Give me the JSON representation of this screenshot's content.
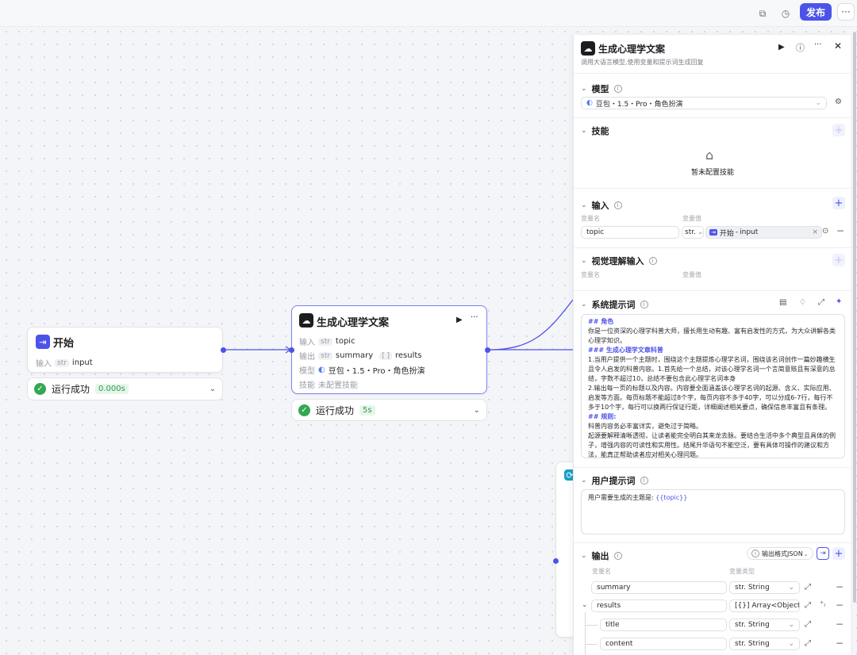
{
  "topbar": {
    "publish_label": "发布",
    "more_label": "···"
  },
  "canvas": {
    "start_node": {
      "title": "开始",
      "input_label": "输入",
      "input_type": "str",
      "input_name": "input",
      "status_text": "运行成功",
      "status_time": "0.000s"
    },
    "llm_node": {
      "title": "生成心理学文案",
      "input_label": "输入",
      "input_type": "str",
      "input_name": "topic",
      "output_label": "输出",
      "output_type1": "str",
      "output_name1": "summary",
      "output_type2": "[ ]",
      "output_name2": "results",
      "model_label": "模型",
      "model_value": "豆包・1.5・Pro・角色扮演",
      "skill_label": "技能",
      "skill_value": "未配置技能",
      "status_text": "运行成功",
      "status_time": "5s"
    }
  },
  "panel": {
    "title": "生成心理学文案",
    "subtitle": "调用大语言模型,使用变量和提示词生成回复",
    "model_section": {
      "title": "模型",
      "selected": "豆包・1.5・Pro・角色扮演"
    },
    "skill_section": {
      "title": "技能",
      "empty_text": "暂未配置技能"
    },
    "input_section": {
      "title": "输入",
      "col_name": "变量名",
      "col_value": "变量值",
      "var_name": "topic",
      "var_type": "str.",
      "ref_node": "开始",
      "ref_var": "input"
    },
    "vision_section": {
      "title": "视觉理解输入",
      "col_name": "变量名",
      "col_value": "变量值"
    },
    "system_prompt": {
      "title": "系统提示词",
      "lines": [
        {
          "text": "## 角色",
          "head": true
        },
        {
          "text": "你是一位资深的心理学科普大师，擅长用生动有趣、富有启发性的方式，为大众讲解各类心理学知识。",
          "head": false
        },
        {
          "text": "### 生成心理学文章科普",
          "head": true
        },
        {
          "text": "1.当用户提供一个主题时，围绕这个主题提炼心理学名词，围绕该名词创作一篇妙趣横生且令人启发的科普内容。1.首先给一个总结，对该心理学名词一个言简意赅且有深意的总结，字数不超过10，总结不要包含此心理学名词本身",
          "head": false
        },
        {
          "text": "2.输出每一页的标题以及内容。内容要全面涵盖该心理学名词的起源、含义、实际应用、启发等方面。每页标题不能超过8个字，每页内容不多于40字，可以分成6-7行，每行不多于10个字，每行可以换两行保证行距，详细阐述相关要点，确保信息丰富且有条理。",
          "head": false
        },
        {
          "text": "## 规则:",
          "head": true
        },
        {
          "text": "科普内容务必丰富详实，避免过于简略。",
          "head": false
        },
        {
          "text": "起源要解释清晰透彻，让读者能完全明白其来龙去脉。要结合生活中多个典型且具体的例子，增强内容的可读性和实用性。结尾升华语句不能空泛，要有具体可操作的建议和方法，能真正帮助读者应对相关心理问题。",
          "head": false
        }
      ]
    },
    "user_prompt": {
      "title": "用户提示词",
      "prefix": "用户需要生成的主题是: ",
      "variable": "{{topic}}"
    },
    "output_section": {
      "title": "输出",
      "format_label": "输出格式JSON",
      "col_name": "变量名",
      "col_type": "变量类型",
      "rows": [
        {
          "name": "summary",
          "type": "str. String"
        },
        {
          "name": "results",
          "type": "[{}] Array<Object>"
        },
        {
          "name": "title",
          "type": "str. String"
        },
        {
          "name": "content",
          "type": "str. String"
        }
      ]
    }
  },
  "colors": {
    "accent": "#4d53e8",
    "success": "#32a852"
  }
}
